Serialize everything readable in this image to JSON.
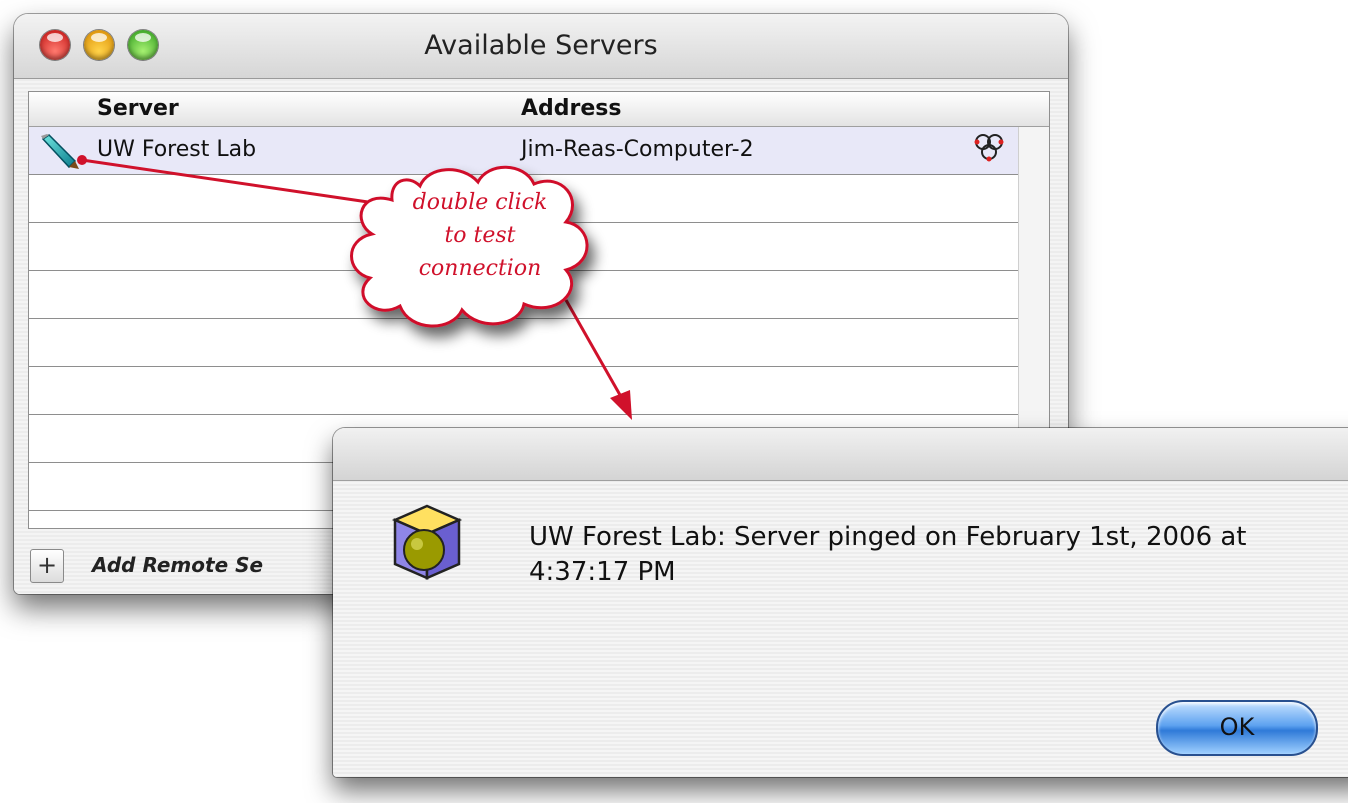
{
  "main_window": {
    "title": "Available Servers",
    "columns": [
      "Server",
      "Address"
    ],
    "rows": [
      {
        "server": "UW Forest Lab",
        "address": "Jim-Reas-Computer-2",
        "icon": "feather-pen-icon",
        "status_icon": "network-status-icon",
        "selected": true
      }
    ],
    "add_button_label": "+",
    "add_label": "Add Remote Se"
  },
  "callout": {
    "line1": "double click",
    "line2": "to test",
    "line3": "connection",
    "color": "#d0112b"
  },
  "alert": {
    "icon": "server-cube-icon",
    "message": "UW Forest Lab: Server pinged on February 1st, 2006 at 4:37:17 PM",
    "ok_label": "OK"
  }
}
